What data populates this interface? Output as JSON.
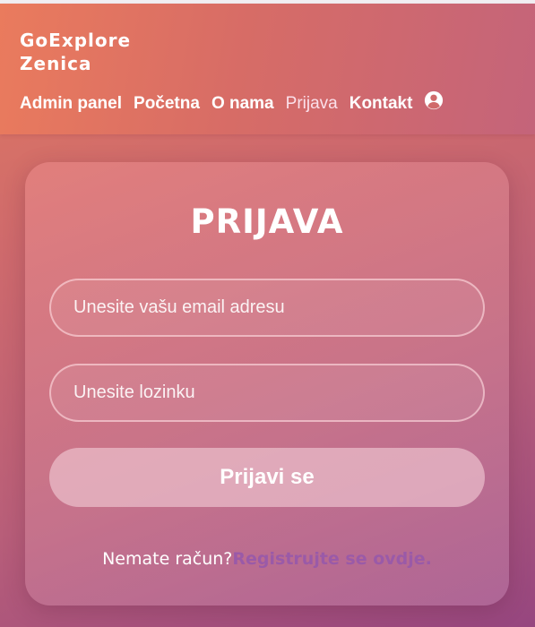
{
  "header": {
    "brand_line1": "GoExplore",
    "brand_line2": "Zenica",
    "nav": {
      "admin": "Admin panel",
      "home": "Početna",
      "about": "O nama",
      "login": "Prijava",
      "contact": "Kontakt"
    },
    "user_icon": "user-circle-icon"
  },
  "login_form": {
    "title": "PRIJAVA",
    "email_placeholder": "Unesite vašu email adresu",
    "password_placeholder": "Unesite lozinku",
    "submit_label": "Prijavi se",
    "register_prompt": "Nemate račun?",
    "register_link": "Registrujte se ovdje."
  },
  "colors": {
    "header_bg": "#e07a60",
    "active_nav": "#fbe0ea",
    "register_link": "#9a5aa8"
  }
}
